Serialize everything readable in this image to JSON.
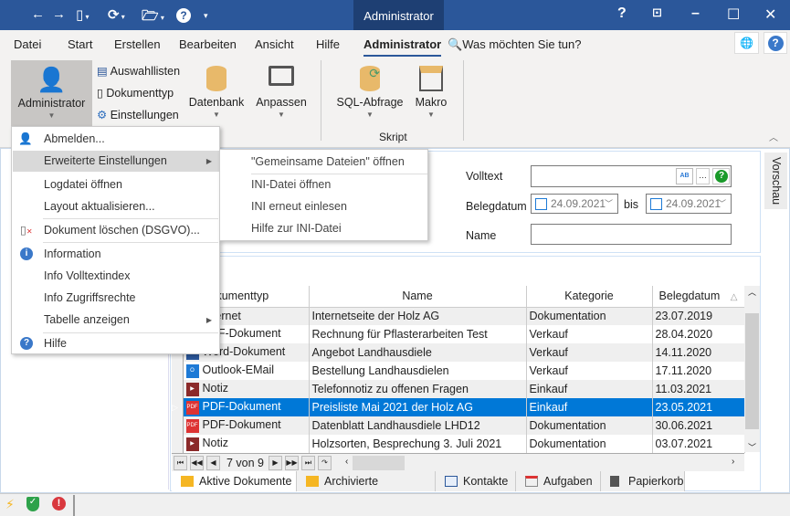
{
  "window": {
    "title": "Administrator",
    "accent": "#2b579a"
  },
  "quick_access": [
    "back-icon",
    "forward-icon",
    "new-document-icon",
    "refresh-icon",
    "open-folder-icon",
    "help-icon"
  ],
  "menu_tabs": [
    "Datei",
    "Start",
    "Erstellen",
    "Bearbeiten",
    "Ansicht",
    "Hilfe",
    "Administrator"
  ],
  "active_menu_tab": "Administrator",
  "tell_me": "Was möchten Sie tun?",
  "ribbon": {
    "administrator": "Administrator",
    "auswahllisten": "Auswahllisten",
    "dokumenttyp": "Dokumenttyp",
    "einstellungen": "Einstellungen",
    "datenbank": "Datenbank",
    "anpassen": "Anpassen",
    "sql": "SQL-Abfrage",
    "makro": "Makro",
    "group_skript": "Skript"
  },
  "admin_menu": {
    "items": [
      "Abmelden...",
      "Erweiterte Einstellungen",
      "Logdatei öffnen",
      "Layout aktualisieren...",
      "Dokument löschen (DSGVO)...",
      "Information",
      "Info Volltextindex",
      "Info Zugriffsrechte",
      "Tabelle anzeigen",
      "Hilfe"
    ],
    "highlighted": "Erweiterte Einstellungen"
  },
  "submenu": {
    "items": [
      "\"Gemeinsame Dateien\" öffnen",
      "INI-Datei öffnen",
      "INI erneut einlesen",
      "Hilfe zur INI-Datei"
    ]
  },
  "search": {
    "volltext_label": "Volltext",
    "volltext_value": "",
    "belegdatum_label": "Belegdatum",
    "date_from": "24.09.2021",
    "bis": "bis",
    "date_to": "24.09.2021",
    "name_label": "Name",
    "name_value": ""
  },
  "vorschau": "Vorschau",
  "grid": {
    "columns": [
      "Dokumenttyp",
      "Name",
      "Kategorie",
      "Belegdatum"
    ],
    "rows": [
      {
        "typ": "Internet",
        "name": "Internetseite der Holz AG",
        "kategorie": "Dokumentation",
        "datum": "23.07.2019"
      },
      {
        "typ": "PDF-Dokument",
        "name": "Rechnung für Pflasterarbeiten Test",
        "kategorie": "Verkauf",
        "datum": "28.04.2020"
      },
      {
        "typ": "Word-Dokument",
        "name": "Angebot Landhausdiele",
        "kategorie": "Verkauf",
        "datum": "14.11.2020"
      },
      {
        "typ": "Outlook-EMail",
        "name": "Bestellung Landhausdielen",
        "kategorie": "Verkauf",
        "datum": "17.11.2020"
      },
      {
        "typ": "Notiz",
        "name": "Telefonnotiz zu offenen Fragen",
        "kategorie": "Einkauf",
        "datum": "11.03.2021"
      },
      {
        "typ": "PDF-Dokument",
        "name": "Preisliste Mai 2021 der Holz AG",
        "kategorie": "Einkauf",
        "datum": "23.05.2021"
      },
      {
        "typ": "PDF-Dokument",
        "name": "Datenblatt Landhausdiele LHD12",
        "kategorie": "Dokumentation",
        "datum": "30.06.2021"
      },
      {
        "typ": "Notiz",
        "name": "Holzsorten, Besprechung 3. Juli 2021",
        "kategorie": "Dokumentation",
        "datum": "03.07.2021"
      }
    ],
    "selected_index": 5,
    "pager": "7 von 9"
  },
  "bottom_tabs": [
    "Aktive Dokumente",
    "Archivierte Dokumente",
    "Kontakte",
    "Aufgaben",
    "Papierkorb"
  ],
  "active_bottom_tab": "Aktive Dokumente"
}
